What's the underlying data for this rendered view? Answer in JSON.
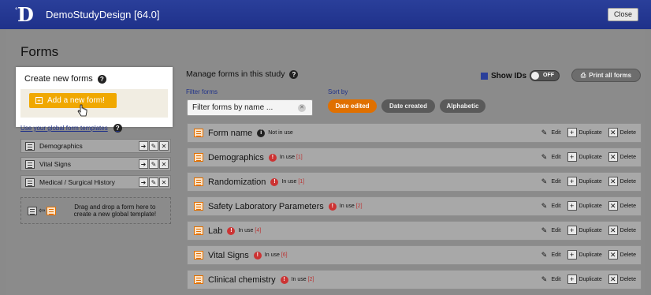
{
  "window": {
    "title": "DemoStudyDesign [64.0]",
    "close_label": "Close"
  },
  "page": {
    "title": "Forms"
  },
  "create": {
    "title": "Create new forms",
    "add_label": "Add a new form!"
  },
  "global": {
    "link_label": "Use your global form templates",
    "templates": [
      {
        "name": "Demographics"
      },
      {
        "name": "Vital Signs"
      },
      {
        "name": "Medical / Surgical History"
      }
    ],
    "dropzone_text": "Drag and drop a form here to create a new global template!"
  },
  "manage": {
    "title": "Manage forms in this study",
    "show_ids_label": "Show IDs",
    "toggle_state": "OFF",
    "print_label": "Print all forms",
    "filter_label": "Filter forms",
    "filter_placeholder": "Filter forms by name ...",
    "sort_label": "Sort by",
    "sort_options": [
      {
        "label": "Date edited",
        "active": true
      },
      {
        "label": "Date created",
        "active": false
      },
      {
        "label": "Alphabetic",
        "active": false
      }
    ]
  },
  "actions": {
    "edit": "Edit",
    "duplicate": "Duplicate",
    "delete": "Delete"
  },
  "forms": [
    {
      "name": "Form name",
      "status": "Not in use",
      "count": "",
      "in_use": false
    },
    {
      "name": "Demographics",
      "status": "In use",
      "count": "[1]",
      "in_use": true
    },
    {
      "name": "Randomization",
      "status": "In use",
      "count": "[1]",
      "in_use": true
    },
    {
      "name": "Safety Laboratory Parameters",
      "status": "In use",
      "count": "[2]",
      "in_use": true
    },
    {
      "name": "Lab",
      "status": "In use",
      "count": "[4]",
      "in_use": true
    },
    {
      "name": "Vital Signs",
      "status": "In use",
      "count": "[6]",
      "in_use": true
    },
    {
      "name": "Clinical chemistry",
      "status": "In use",
      "count": "[2]",
      "in_use": true
    }
  ],
  "colors": {
    "brand": "#1f318a",
    "accent": "#f0a800",
    "active_sort": "#e07000",
    "in_use_icon": "#cc3333"
  }
}
